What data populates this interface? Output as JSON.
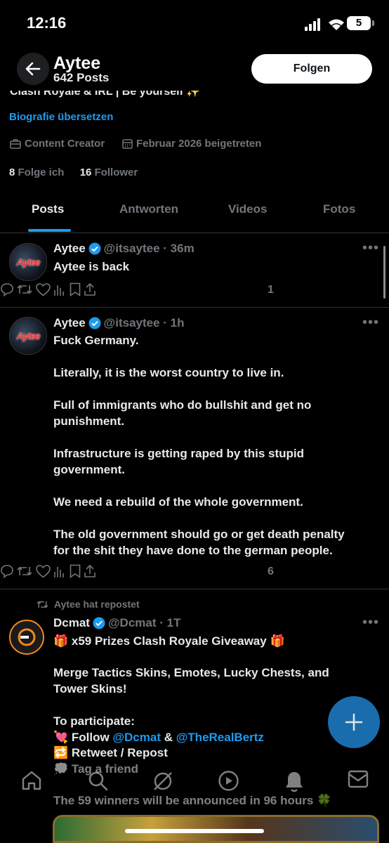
{
  "status_bar": {
    "time": "12:16",
    "battery": "5"
  },
  "header": {
    "title": "Aytee",
    "posts_count": "642 Posts",
    "follow_label": "Folgen"
  },
  "profile": {
    "bio_partial": "Clash Royale & IRL | Be yourself ✨",
    "translate_label": "Biografie übersetzen",
    "category": "Content Creator",
    "joined": "Februar 2026 beigetreten",
    "following_count": "8",
    "following_label": "Folge ich",
    "followers_count": "16",
    "followers_label": "Follower"
  },
  "tabs": [
    {
      "label": "Posts"
    },
    {
      "label": "Antworten"
    },
    {
      "label": "Videos"
    },
    {
      "label": "Fotos"
    }
  ],
  "tweets": [
    {
      "name": "Aytee",
      "handle_time": "@itsaytee · 36m",
      "text": "Aytee is back",
      "views": "1",
      "avatar_text": "Aytee"
    },
    {
      "name": "Aytee",
      "handle_time": "@itsaytee · 1h",
      "text": "Fuck Germany.\n\nLiterally, it is the worst country to live in.\n\nFull of immigrants who do bullshit and get no punishment.\n\nInfrastructure is getting raped by this stupid government.\n\nWe need a rebuild of the whole government.\n\nThe old government should go or get death penalty for the shit they have done to the german people.",
      "views": "6",
      "avatar_text": "Aytee"
    }
  ],
  "repost": {
    "label": "Aytee hat repostet",
    "name": "Dcmat",
    "handle_time": "@Dcmat · 1T",
    "line1": "🎁 x59 Prizes Clash Royale Giveaway 🎁",
    "line2": "Merge Tactics Skins, Emotes, Lucky Chests, and Tower Skins!",
    "line3": "To participate:",
    "follow_prefix": "💘 Follow ",
    "mention1": "@Dcmat",
    "amp": " & ",
    "mention2": "@TheRealBertz",
    "line5": "🔁 Retweet / Repost",
    "line6": "💭 Tag a friend",
    "line7": "The 59 winners will be announced in 96 hours 🍀"
  },
  "colors": {
    "accent": "#1d9bf0",
    "background": "#000000",
    "muted": "#71767b"
  }
}
